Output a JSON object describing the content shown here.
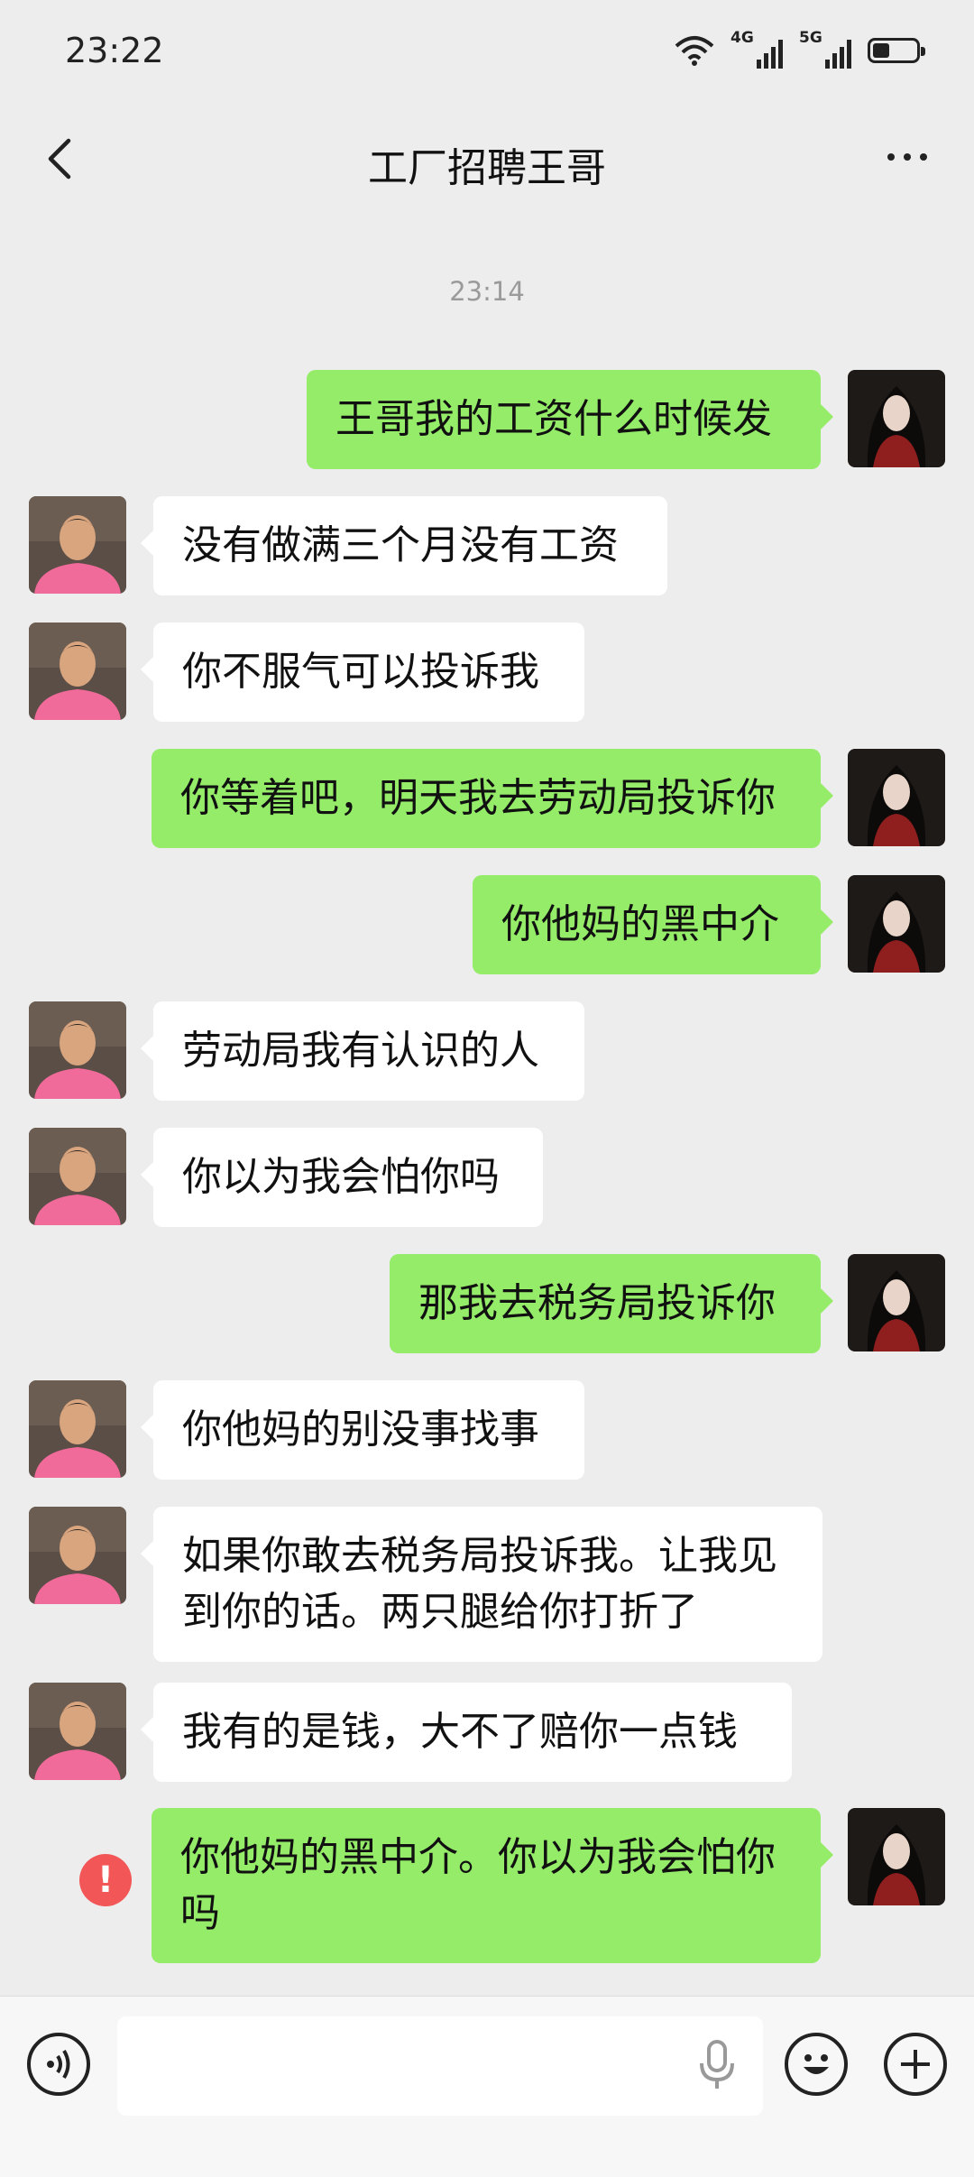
{
  "status_bar": {
    "time": "23:22",
    "net1": "4G",
    "net2": "5G",
    "battery_level": 0.4
  },
  "header": {
    "title": "工厂招聘王哥"
  },
  "timestamp": "23:14",
  "messages": [
    {
      "side": "out",
      "text": "王哥我的工资什么时候发"
    },
    {
      "side": "in",
      "text": "没有做满三个月没有工资"
    },
    {
      "side": "in",
      "text": "你不服气可以投诉我"
    },
    {
      "side": "out",
      "text": "你等着吧，明天我去劳动局投诉你"
    },
    {
      "side": "out",
      "text": "你他妈的黑中介"
    },
    {
      "side": "in",
      "text": "劳动局我有认识的人"
    },
    {
      "side": "in",
      "text": "你以为我会怕你吗"
    },
    {
      "side": "out",
      "text": "那我去税务局投诉你"
    },
    {
      "side": "in",
      "text": "你他妈的别没事找事"
    },
    {
      "side": "in",
      "text": "如果你敢去税务局投诉我。让我见到你的话。两只腿给你打折了"
    },
    {
      "side": "in",
      "text": "我有的是钱，大不了赔你一点钱"
    },
    {
      "side": "out",
      "text": "你他妈的黑中介。你以为我会怕你吗",
      "failed": true
    }
  ],
  "error_mark": "!",
  "input_bar": {
    "placeholder": ""
  },
  "colors": {
    "outgoing_bubble": "#95ec69",
    "incoming_bubble": "#ffffff",
    "error": "#f25656",
    "background": "#ededed"
  }
}
